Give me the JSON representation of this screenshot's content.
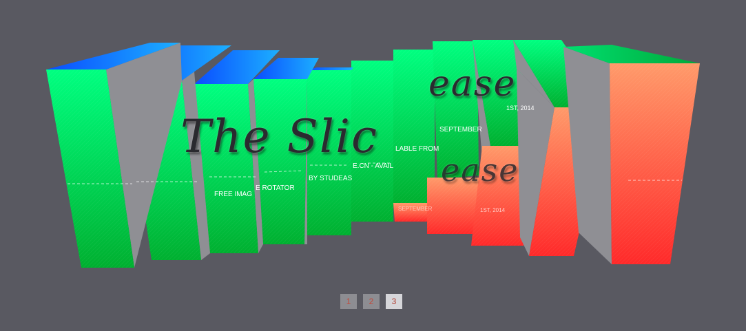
{
  "slider": {
    "title_fragments": [
      "The Slic",
      "ease"
    ],
    "subtitle_fragments": [
      "FREE IMAG",
      "E ROTATOR",
      "BY STUDEAS",
      "E.CN - AVAIL",
      "LABLE FROM",
      "SEPTEMBER",
      "1ST, 2014"
    ],
    "reflection_fragments": [
      "ease",
      "SEPTEMBER",
      "1ST, 2014"
    ],
    "colors": {
      "background": "#595961",
      "face_green_top": "#00ff80",
      "face_green_bottom": "#00b030",
      "face_blue": "#1a7cff",
      "face_orange_top": "#ff9a6a",
      "face_red_bottom": "#ff2a2a",
      "side_gray": "#8f8f94"
    }
  },
  "pagination": {
    "items": [
      {
        "label": "1",
        "active": false
      },
      {
        "label": "2",
        "active": false
      },
      {
        "label": "3",
        "active": true
      }
    ]
  }
}
